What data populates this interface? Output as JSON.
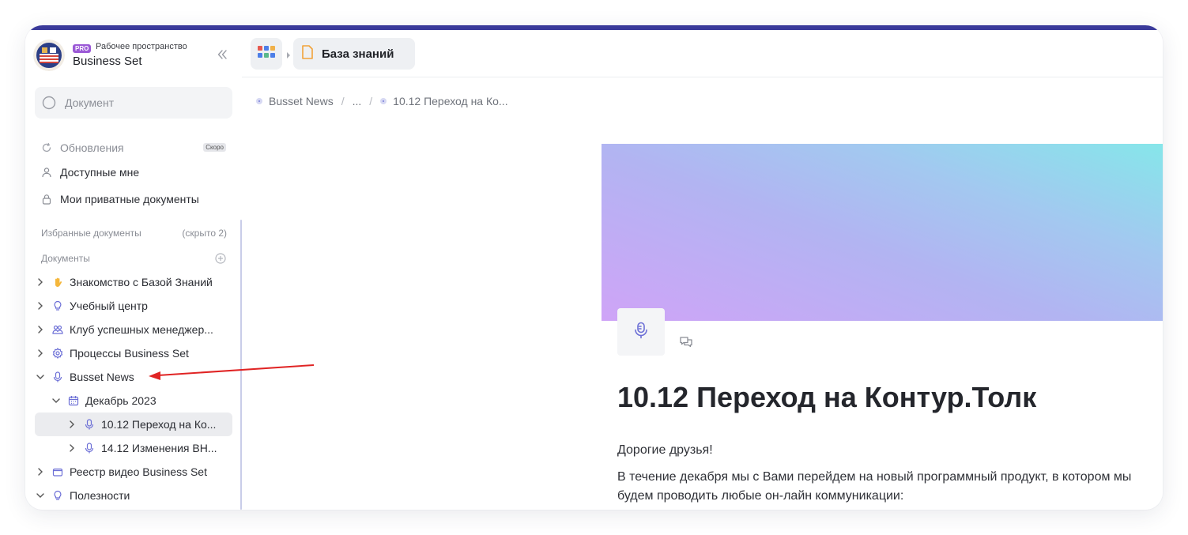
{
  "workspace": {
    "pro_badge": "PRO",
    "caption": "Рабочее пространство",
    "name": "Business Set"
  },
  "search": {
    "placeholder": "Документ"
  },
  "nav": [
    {
      "label": "Обновления",
      "badge": "Скоро",
      "icon": "refresh-icon"
    },
    {
      "label": "Доступные мне",
      "icon": "user-icon"
    },
    {
      "label": "Мои приватные документы",
      "icon": "lock-icon"
    }
  ],
  "sections": {
    "favorites": {
      "label": "Избранные документы",
      "aux": "(скрыто 2)"
    },
    "documents": {
      "label": "Документы"
    }
  },
  "tree": [
    {
      "label": "Знакомство с Базой Знаний",
      "icon": "hand-icon",
      "expanded": false,
      "level": 0
    },
    {
      "label": "Учебный центр",
      "icon": "lightbulb-icon",
      "expanded": false,
      "level": 0
    },
    {
      "label": "Клуб успешных менеджер...",
      "icon": "group-icon",
      "expanded": false,
      "level": 0
    },
    {
      "label": "Процессы Business Set",
      "icon": "gear-icon",
      "expanded": false,
      "level": 0
    },
    {
      "label": "Busset News",
      "icon": "microphone-icon",
      "expanded": true,
      "level": 0
    },
    {
      "label": "Декабрь 2023",
      "icon": "calendar-icon",
      "expanded": true,
      "level": 1
    },
    {
      "label": "10.12 Переход на Ко...",
      "icon": "microphone-icon",
      "expanded": false,
      "level": 2,
      "selected": true
    },
    {
      "label": "14.12 Изменения ВН...",
      "icon": "microphone-icon",
      "expanded": false,
      "level": 2
    },
    {
      "label": "Реестр видео Business Set",
      "icon": "folder-icon",
      "expanded": false,
      "level": 0
    },
    {
      "label": "Полезности",
      "icon": "lightbulb-icon",
      "expanded": true,
      "level": 0
    }
  ],
  "header": {
    "tab_label": "База знаний"
  },
  "breadcrumbs": {
    "first": "Busset News",
    "middle": "...",
    "last": "10.12 Переход на Ко...",
    "separator": "/"
  },
  "document": {
    "title": "10.12 Переход на Контур.Толк",
    "paragraphs": [
      "Дорогие друзья!",
      "В течение декабря мы с Вами перейдем на новый программный продукт, в котором мы будем проводить любые он-лайн коммуникации:"
    ]
  },
  "colors": {
    "accent": "#3a3a9a",
    "icon": "#6c6fd6",
    "annotation_arrow": "#e02424"
  }
}
